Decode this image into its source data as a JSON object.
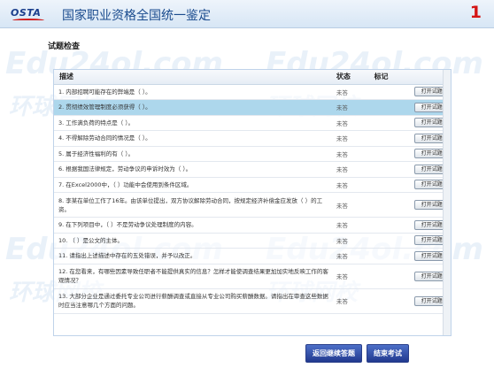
{
  "header": {
    "logo_text": "OSTA",
    "title": "国家职业资格全国统一鉴定",
    "page_number": "1"
  },
  "section_title": "试题检查",
  "table": {
    "columns": {
      "desc": "描述",
      "status": "状态",
      "mark": "标记"
    },
    "action_label": "打开试题",
    "rows": [
      {
        "desc": "1. 内部招聘可能存在的弊端是（     ）。",
        "status": "未答",
        "mark": ""
      },
      {
        "desc": "2. 贯彻绩效管理制度必须获得（     ）。",
        "status": "未答",
        "mark": ""
      },
      {
        "desc": "3. 工作满负荷的特点是（     ）。",
        "status": "未答",
        "mark": ""
      },
      {
        "desc": "4. 不得解除劳动合同的情况是（     ）。",
        "status": "未答",
        "mark": ""
      },
      {
        "desc": "5. 属于经济性福利的有（     ）。",
        "status": "未答",
        "mark": ""
      },
      {
        "desc": "6. 根据我国法律规定，劳动争议的申诉时效为（     ）。",
        "status": "未答",
        "mark": ""
      },
      {
        "desc": "7. 在Excel2000中，（     ）功能中会使用到条件区域。",
        "status": "未答",
        "mark": ""
      },
      {
        "desc": "8. 李某在单位工作了16年。由该单位提出，双方协议解除劳动合同，按规定经济补偿金应发放（     ）的工资。",
        "status": "未答",
        "mark": ""
      },
      {
        "desc": "9. 在下列项目中，（     ）不是劳动争议处理制度的内容。",
        "status": "未答",
        "mark": ""
      },
      {
        "desc": "10. （     ）是公文的主体。",
        "status": "未答",
        "mark": ""
      },
      {
        "desc": "11. 请指出上述描述中存在的五处错误，并予以改正。",
        "status": "未答",
        "mark": ""
      },
      {
        "desc": "12. 在您看来，有哪些因素导致任职者不能提供真实的信息？怎样才能使调查结果更加加实地反映工作的客观情况？",
        "status": "未答",
        "mark": ""
      },
      {
        "desc": "13. 大部分企业是通过委托专业公司进行薪酬调查或直接从专业公司购买薪酬数据。请指出在审查这些数据时应当注意哪几个方面的问题。",
        "status": "未答",
        "mark": ""
      }
    ]
  },
  "footer": {
    "return_label": "返回继续答题",
    "end_label": "结束考试"
  },
  "watermark": {
    "text_a": "Edu24ol.com",
    "text_b": "环球网校"
  },
  "colors": {
    "brand_blue": "#1a4b8e",
    "page_number_red": "#d41515",
    "row_highlight": "#add7ec",
    "button_blue": "#2a45a0"
  }
}
